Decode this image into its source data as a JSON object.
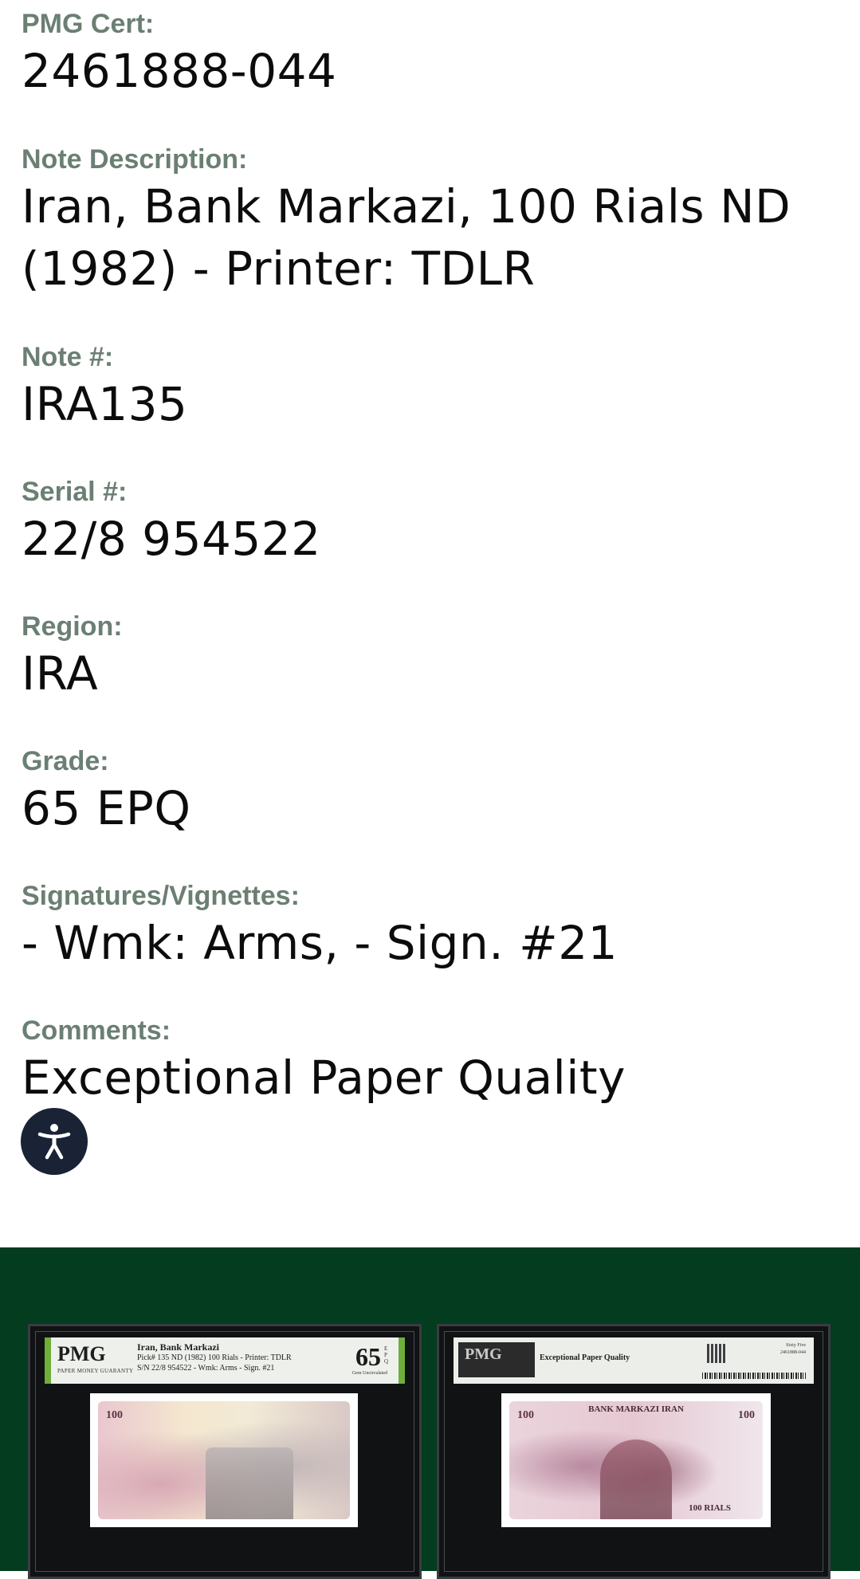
{
  "fields": [
    {
      "label": "PMG Cert:",
      "value": "2461888-044"
    },
    {
      "label": "Note Description:",
      "value_lines": [
        "Iran, Bank Markazi, 100 Rials ND",
        "(1982) - Printer: TDLR"
      ]
    },
    {
      "label": "Note #:",
      "value": "IRA135"
    },
    {
      "label": "Serial #:",
      "value": "22/8 954522"
    },
    {
      "label": "Region:",
      "value": "IRA"
    },
    {
      "label": "Grade:",
      "value": "65 EPQ"
    },
    {
      "label": "Signatures/Vignettes:",
      "value": "- Wmk: Arms, - Sign. #21"
    },
    {
      "label": "Comments:",
      "value": "Exceptional Paper Quality"
    }
  ],
  "accessibility": {
    "icon": "accessibility-icon",
    "color": "#1a2236"
  },
  "images_band": {
    "background": "#033c1f"
  },
  "front_holder": {
    "logo": "PMG",
    "guarantee": "PAPER MONEY GUARANTY",
    "line1": "Iran, Bank Markazi",
    "line2": "Pick# 135  ND (1982)  100 Rials - Printer: TDLR",
    "line3": "S/N 22/8 954522 - Wmk: Arms - Sign. #21",
    "grade": "65",
    "grade_suffix": "EPQ",
    "grade_desc": "Gem Uncirculated",
    "denomination": "100"
  },
  "back_holder": {
    "logo": "PMG",
    "quality": "Exceptional Paper Quality",
    "grade_words": "Sixty Five",
    "cert": "2461888-044",
    "note_title": "BANK MARKAZI IRAN",
    "denomination": "100",
    "rials": "100 RIALS"
  }
}
